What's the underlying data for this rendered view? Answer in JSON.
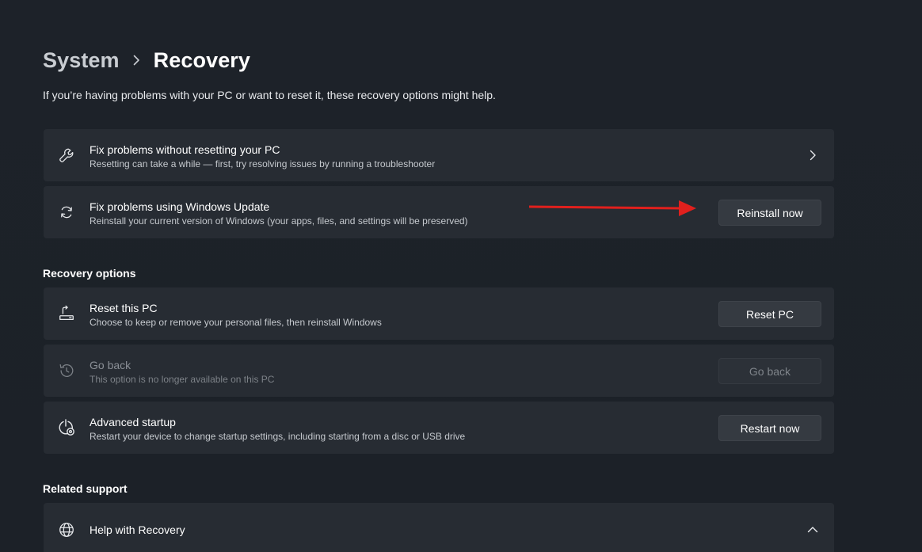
{
  "breadcrumb": {
    "parent": "System",
    "current": "Recovery"
  },
  "subtitle": "If you’re having problems with your PC or want to reset it, these recovery options might help.",
  "top_cards": [
    {
      "icon": "wrench-icon",
      "title": "Fix problems without resetting your PC",
      "description": "Resetting can take a while — first, try resolving issues by running a troubleshooter"
    },
    {
      "icon": "sync-icon",
      "title": "Fix problems using Windows Update",
      "description": "Reinstall your current version of Windows (your apps, files, and settings will be preserved)",
      "button": "Reinstall now"
    }
  ],
  "recovery_options": {
    "heading": "Recovery options",
    "items": [
      {
        "icon": "reset-pc-icon",
        "title": "Reset this PC",
        "description": "Choose to keep or remove your personal files, then reinstall Windows",
        "button": "Reset PC",
        "enabled": true
      },
      {
        "icon": "history-icon",
        "title": "Go back",
        "description": "This option is no longer available on this PC",
        "button": "Go back",
        "enabled": false
      },
      {
        "icon": "advanced-startup-icon",
        "title": "Advanced startup",
        "description": "Restart your device to change startup settings, including starting from a disc or USB drive",
        "button": "Restart now",
        "enabled": true
      }
    ]
  },
  "related_support": {
    "heading": "Related support",
    "item": {
      "icon": "globe-icon",
      "title": "Help with Recovery",
      "expanded": true
    }
  },
  "annotation": {
    "arrow_color": "#e0201d"
  },
  "colors": {
    "background": "#1c2128",
    "card": "#272c33",
    "button": "#353a41"
  }
}
